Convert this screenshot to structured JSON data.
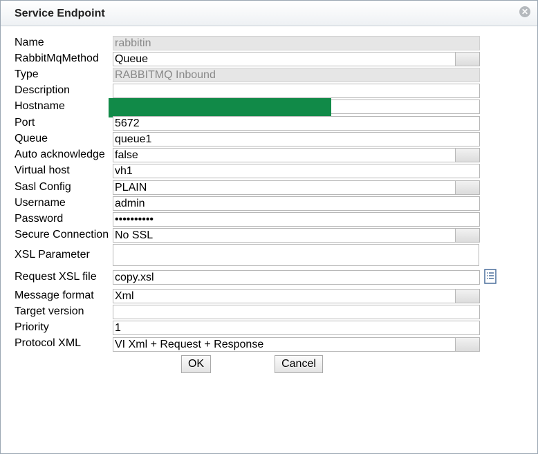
{
  "dialog": {
    "title": "Service Endpoint",
    "close_icon": "close-circle-icon"
  },
  "form": {
    "name": {
      "label": "Name",
      "value": "rabbitin"
    },
    "rabbitmq_method": {
      "label": "RabbitMqMethod",
      "value": "Queue"
    },
    "type": {
      "label": "Type",
      "value": "RABBITMQ Inbound"
    },
    "description": {
      "label": "Description",
      "value": ""
    },
    "hostname": {
      "label": "Hostname",
      "value": ""
    },
    "port": {
      "label": "Port",
      "value": "5672"
    },
    "queue": {
      "label": "Queue",
      "value": "queue1"
    },
    "auto_ack": {
      "label": "Auto acknowledge",
      "value": "false"
    },
    "virtual_host": {
      "label": "Virtual host",
      "value": "vh1"
    },
    "sasl_config": {
      "label": "Sasl Config",
      "value": "PLAIN"
    },
    "username": {
      "label": "Username",
      "value": "admin"
    },
    "password": {
      "label": "Password",
      "value": "••••••••••"
    },
    "secure_connection": {
      "label": "Secure Connection",
      "value": "No SSL"
    },
    "xsl_parameter": {
      "label": "XSL Parameter",
      "value": ""
    },
    "request_xsl": {
      "label": "Request XSL file",
      "value": "copy.xsl",
      "icon": "list-document-icon"
    },
    "message_format": {
      "label": "Message format",
      "value": "Xml"
    },
    "target_version": {
      "label": "Target version",
      "value": ""
    },
    "priority": {
      "label": "Priority",
      "value": "1"
    },
    "protocol_xml": {
      "label": "Protocol XML",
      "value": "VI Xml + Request + Response"
    }
  },
  "buttons": {
    "ok": "OK",
    "cancel": "Cancel"
  },
  "colors": {
    "redaction": "#118a48",
    "readonly_bg": "#e6e6e6",
    "readonly_text": "#888888"
  }
}
